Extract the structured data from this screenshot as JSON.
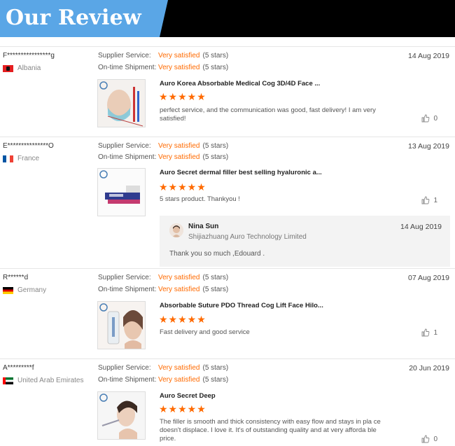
{
  "header": {
    "title": "Our Review"
  },
  "labels": {
    "supplier_service": "Supplier Service:",
    "on_time_shipment": "On-time Shipment:"
  },
  "reviews": [
    {
      "user": "F****************g",
      "country": "Albania",
      "supplier_service": "Very satisfied",
      "supplier_stars": "(5 stars)",
      "shipment": "Very satisfied",
      "shipment_stars": "(5 stars)",
      "date": "14 Aug 2019",
      "product": "Auro Korea Absorbable Medical Cog 3D/4D Face ...",
      "rating": "★★★★★",
      "text": "perfect service, and the communication was good, fast delivery! I am very satisfied!",
      "likes": "0"
    },
    {
      "user": "E***************O",
      "country": "France",
      "supplier_service": "Very satisfied",
      "supplier_stars": "(5 stars)",
      "shipment": "Very satisfied",
      "shipment_stars": "(5 stars)",
      "date": "13 Aug 2019",
      "product": "Auro Secret dermal filler best selling hyaluronic a...",
      "rating": "★★★★★",
      "text": "5 stars product. Thankyou !",
      "likes": "1",
      "reply": {
        "name": "Nina Sun",
        "company": "Shijiazhuang Auro Technology Limited",
        "date": "14 Aug 2019",
        "message": "Thank you so much ,Edouard ."
      }
    },
    {
      "user": "R******d",
      "country": "Germany",
      "supplier_service": "Very satisfied",
      "supplier_stars": "(5 stars)",
      "shipment": "Very satisfied",
      "shipment_stars": "(5 stars)",
      "date": "07 Aug 2019",
      "product": "Absorbable Suture PDO Thread Cog Lift Face Hilo...",
      "rating": "★★★★★",
      "text": "Fast delivery and good service",
      "likes": "1"
    },
    {
      "user": "A*********f",
      "country": "United Arab Emirates",
      "supplier_service": "Very satisfied",
      "supplier_stars": "(5 stars)",
      "shipment": "Very satisfied",
      "shipment_stars": "(5 stars)",
      "date": "20 Jun 2019",
      "product": "Auro Secret Deep",
      "rating": "★★★★★",
      "text": "The filler is smooth and thick consistency with easy flow and stays in pla ce doesn't displace. I love it. It's of outstanding quality and at very afforda ble price.",
      "likes": "0"
    }
  ],
  "colors": {
    "accent": "#ff6a00",
    "banner_blue": "#5aa6e6"
  }
}
